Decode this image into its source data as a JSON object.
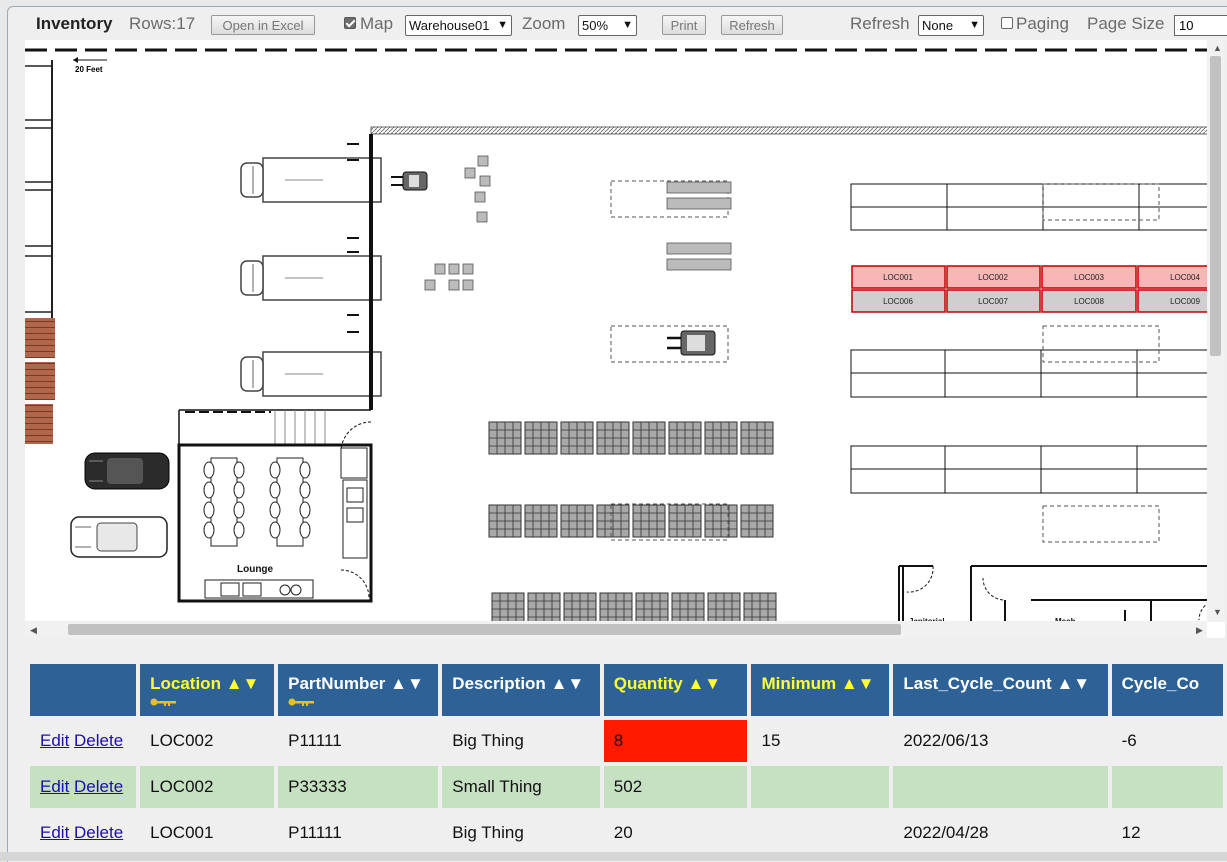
{
  "toolbar": {
    "title": "Inventory",
    "rows_label": "Rows:",
    "rows_count": "17",
    "open_excel": "Open in Excel",
    "map_label": "Map",
    "map_checked": true,
    "warehouse": "Warehouse01",
    "zoom_label": "Zoom",
    "zoom": "50%",
    "print": "Print",
    "refresh_button": "Refresh",
    "refresh_label": "Refresh",
    "refresh_value": "None",
    "paging_label": "Paging",
    "paging_checked": false,
    "page_size_label": "Page Size",
    "page_size": "10"
  },
  "map": {
    "scale_label": "20 Feet",
    "lounge_label": "Lounge",
    "janitorial_label": "Janitorial",
    "mech_label": "Mech",
    "highlighted_locations": [
      "LOC001",
      "LOC002",
      "LOC003",
      "LOC004"
    ],
    "locations_row2": [
      "LOC006",
      "LOC007",
      "LOC008",
      "LOC009"
    ],
    "highlight_color": "#f7b7b7",
    "highlight_border": "#c00000"
  },
  "table": {
    "actions": {
      "edit": "Edit",
      "delete": "Delete"
    },
    "sort_glyph": "▲▼",
    "columns": [
      {
        "label": "",
        "key": false
      },
      {
        "label": "Location",
        "key": true
      },
      {
        "label": "PartNumber",
        "key": true
      },
      {
        "label": "Description",
        "key": false
      },
      {
        "label": "Quantity",
        "key": true
      },
      {
        "label": "Minimum",
        "key": true
      },
      {
        "label": "Last_Cycle_Count",
        "key": false
      },
      {
        "label": "Cycle_Co",
        "key": false
      }
    ],
    "rows": [
      {
        "location": "LOC002",
        "part": "P11111",
        "description": "Big Thing",
        "quantity": "8",
        "minimum": "15",
        "last_cycle": "2022/06/13",
        "cycle": "-6",
        "low": true
      },
      {
        "location": "LOC002",
        "part": "P33333",
        "description": "Small Thing",
        "quantity": "502",
        "minimum": "",
        "last_cycle": "",
        "cycle": "",
        "low": false
      },
      {
        "location": "LOC001",
        "part": "P11111",
        "description": "Big Thing",
        "quantity": "20",
        "minimum": "",
        "last_cycle": "2022/04/28",
        "cycle": "12",
        "low": false
      }
    ],
    "header_color": "#2e6195",
    "key_color": "#ffff33",
    "alt_row_color": "#c6e0c2",
    "low_color": "#ff1a00"
  }
}
